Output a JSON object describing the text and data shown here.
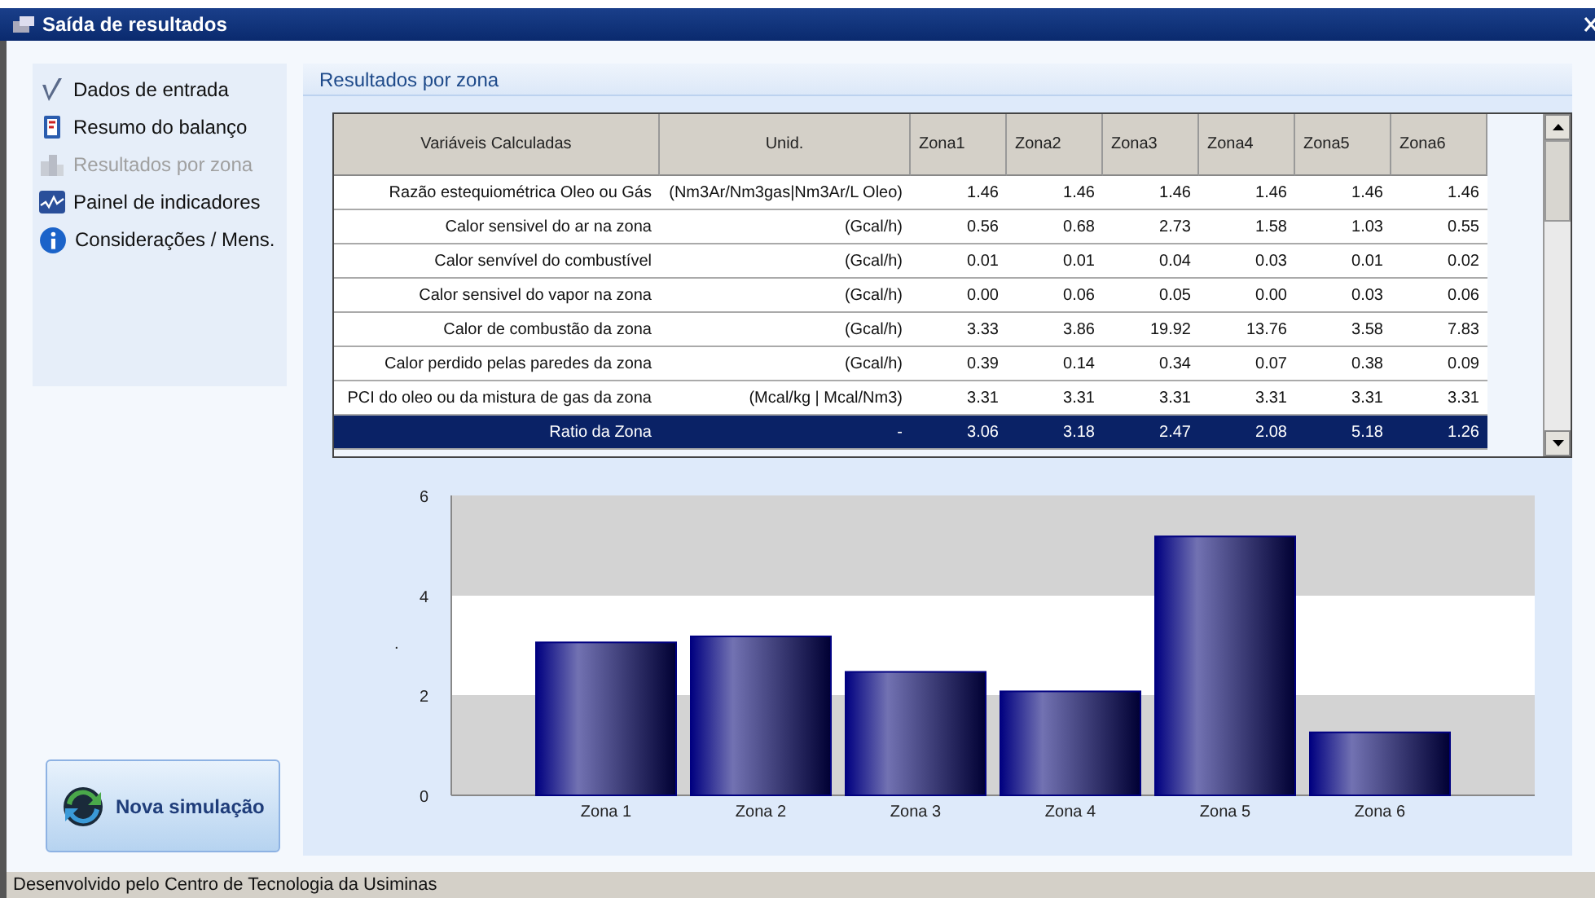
{
  "window": {
    "title": "Saída de resultados"
  },
  "sidebar": {
    "items": [
      {
        "label": "Dados de entrada",
        "disabled": false
      },
      {
        "label": "Resumo do balanço",
        "disabled": false
      },
      {
        "label": "Resultados por zona",
        "disabled": true
      },
      {
        "label": "Painel de indicadores",
        "disabled": false
      },
      {
        "label": "Considerações / Mens.",
        "disabled": false
      }
    ]
  },
  "new_simulation_button": {
    "label": "Nova simulação"
  },
  "panel": {
    "title": "Resultados por zona"
  },
  "table": {
    "columns": [
      "Variáveis Calculadas",
      "Unid.",
      "Zona1",
      "Zona2",
      "Zona3",
      "Zona4",
      "Zona5",
      "Zona6"
    ],
    "rows": [
      {
        "cells": [
          "Razão estequiométrica Oleo ou Gás",
          "(Nm3Ar/Nm3gas|Nm3Ar/L Oleo)",
          "1.46",
          "1.46",
          "1.46",
          "1.46",
          "1.46",
          "1.46"
        ],
        "selected": false
      },
      {
        "cells": [
          "Calor sensivel do ar na zona",
          "(Gcal/h)",
          "0.56",
          "0.68",
          "2.73",
          "1.58",
          "1.03",
          "0.55"
        ],
        "selected": false
      },
      {
        "cells": [
          "Calor senvível do combustível",
          "(Gcal/h)",
          "0.01",
          "0.01",
          "0.04",
          "0.03",
          "0.01",
          "0.02"
        ],
        "selected": false
      },
      {
        "cells": [
          "Calor sensivel do vapor na zona",
          "(Gcal/h)",
          "0.00",
          "0.06",
          "0.05",
          "0.00",
          "0.03",
          "0.06"
        ],
        "selected": false
      },
      {
        "cells": [
          "Calor de combustão da zona",
          "(Gcal/h)",
          "3.33",
          "3.86",
          "19.92",
          "13.76",
          "3.58",
          "7.83"
        ],
        "selected": false
      },
      {
        "cells": [
          "Calor perdido pelas paredes da zona",
          "(Gcal/h)",
          "0.39",
          "0.14",
          "0.34",
          "0.07",
          "0.38",
          "0.09"
        ],
        "selected": false
      },
      {
        "cells": [
          "PCI do oleo ou da mistura de gas da zona",
          "(Mcal/kg | Mcal/Nm3)",
          "3.31",
          "3.31",
          "3.31",
          "3.31",
          "3.31",
          "3.31"
        ],
        "selected": false
      },
      {
        "cells": [
          "Ratio da Zona",
          "-",
          "3.06",
          "3.18",
          "2.47",
          "2.08",
          "5.18",
          "1.26"
        ],
        "selected": true
      }
    ]
  },
  "chart": {
    "chart_data": {
      "type": "bar",
      "ylabel": ".",
      "categories": [
        "Zona 1",
        "Zona 2",
        "Zona 3",
        "Zona 4",
        "Zona 5",
        "Zona 6"
      ],
      "series": [
        {
          "color": "#000080",
          "values": [
            3.06,
            3.18,
            2.47,
            2.08,
            5.18,
            1.26
          ]
        }
      ],
      "ylim": [
        0,
        6
      ],
      "yticks": [
        0,
        2,
        4,
        6
      ]
    }
  },
  "status_bar": "Desenvolvido pelo Centro de Tecnologia da Usiminas"
}
